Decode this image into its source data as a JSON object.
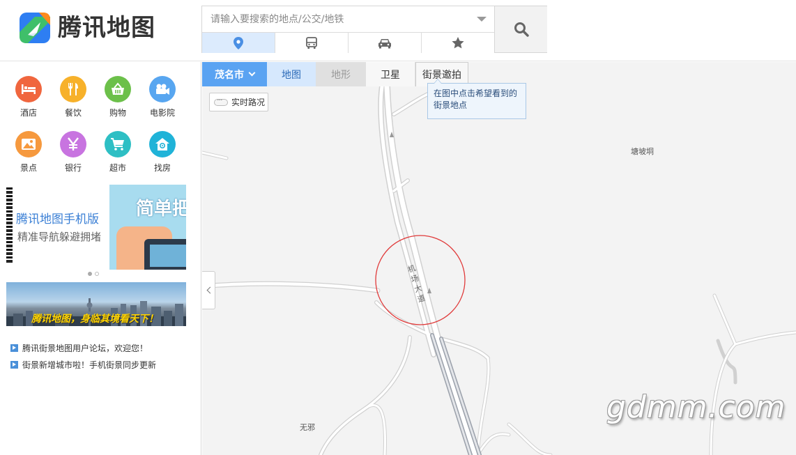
{
  "app": {
    "logo_text": "腾讯地图",
    "brand_colors": {
      "blue": "#2e7ef2",
      "orange": "#ff8a1c",
      "green": "#3fbf6a"
    }
  },
  "search": {
    "placeholder": "请输入要搜索的地点/公交/地铁",
    "mode_tabs": [
      {
        "icon": "location-pin-icon",
        "active": true
      },
      {
        "icon": "bus-icon",
        "active": false
      },
      {
        "icon": "car-icon",
        "active": false
      },
      {
        "icon": "star-icon",
        "active": false
      }
    ],
    "button_icon": "search-icon"
  },
  "categories": [
    {
      "label": "酒店",
      "icon": "hotel-bed-icon",
      "color": "#f0663e"
    },
    {
      "label": "餐饮",
      "icon": "fork-knife-icon",
      "color": "#f7b12a"
    },
    {
      "label": "购物",
      "icon": "shopping-basket-icon",
      "color": "#6cc04a"
    },
    {
      "label": "电影院",
      "icon": "movie-camera-icon",
      "color": "#58a6f0"
    },
    {
      "label": "景点",
      "icon": "mountain-icon",
      "color": "#f6993e"
    },
    {
      "label": "银行",
      "icon": "yen-icon",
      "color": "#c874e0"
    },
    {
      "label": "超市",
      "icon": "shopping-cart-icon",
      "color": "#2ebfc4"
    },
    {
      "label": "找房",
      "icon": "house-icon",
      "color": "#20b3d8"
    }
  ],
  "banner": {
    "title": "腾讯地图手机版",
    "subtitle": "精准导航躲避拥堵",
    "art_text": "简单把"
  },
  "promo": {
    "text": "腾讯地图，身临其境看天下！"
  },
  "news": [
    {
      "text": "腾讯街景地图用户论坛，欢迎您！"
    },
    {
      "text": "街景新增城市啦！手机街景同步更新"
    }
  ],
  "map": {
    "city": "茂名市",
    "layers": [
      {
        "label": "地图",
        "state": "active"
      },
      {
        "label": "地形",
        "state": "disabled"
      },
      {
        "label": "卫星",
        "state": "normal"
      }
    ],
    "street_view": "街景邀拍",
    "tooltip": "在图中点击希望看到的街景地点",
    "traffic": "实时路况",
    "places": {
      "tangpodong": "塘坡垌",
      "wuxie": "无邪"
    },
    "road_label": "机场大道",
    "watermark": "gdmm.com"
  }
}
